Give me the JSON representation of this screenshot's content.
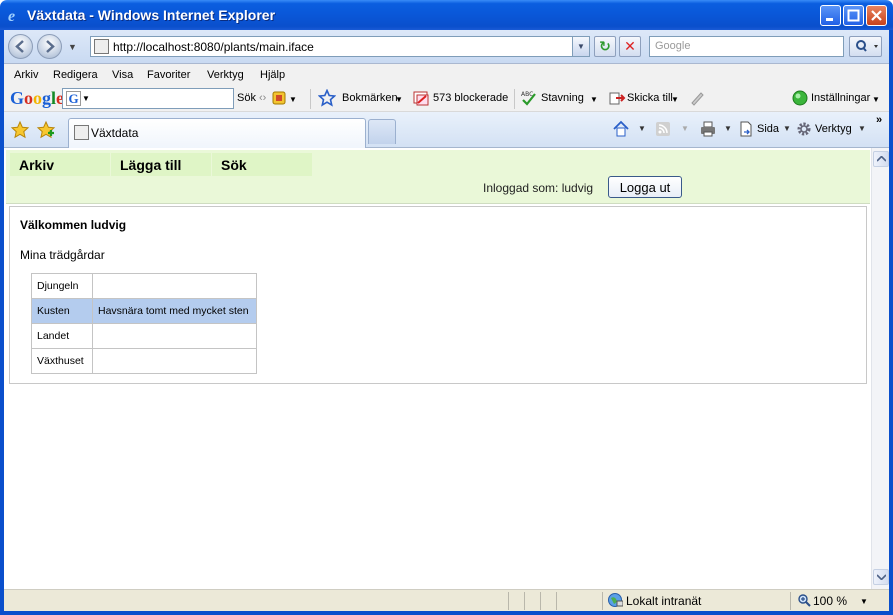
{
  "window": {
    "title": "Växtdata - Windows Internet Explorer"
  },
  "address_bar": {
    "url": "http://localhost:8080/plants/main.iface",
    "search_placeholder": "Google"
  },
  "menu": {
    "items": [
      "Arkiv",
      "Redigera",
      "Visa",
      "Favoriter",
      "Verktyg",
      "Hjälp"
    ]
  },
  "google_toolbar": {
    "logo": "Google",
    "search_label": "Sök",
    "bookmarks_label": "Bokmärken",
    "blocked_label": "573 blockerade",
    "spelling_label": "Stavning",
    "send_to_label": "Skicka till",
    "settings_label": "Inställningar"
  },
  "tabs": {
    "active_label": "Växtdata"
  },
  "command_bar": {
    "page_label": "Sida",
    "tools_label": "Verktyg"
  },
  "app": {
    "nav": [
      "Arkiv",
      "Lägga till",
      "Sök"
    ],
    "logged_in_text": "Inloggad som: ludvig",
    "logout_label": "Logga ut",
    "welcome": "Välkommen ludvig",
    "gardens_title": "Mina trädgårdar",
    "gardens": [
      {
        "name": "Djungeln",
        "description": ""
      },
      {
        "name": "Kusten",
        "description": "Havsnära tomt med mycket sten",
        "selected": true
      },
      {
        "name": "Landet",
        "description": ""
      },
      {
        "name": "Växthuset",
        "description": ""
      }
    ]
  },
  "status_bar": {
    "zone": "Lokalt intranät",
    "zoom": "100 %"
  },
  "colors": {
    "app_header_bg": "#eaf8d8",
    "selected_row_bg": "#b4ccee",
    "titlebar": "#0a57d8"
  }
}
